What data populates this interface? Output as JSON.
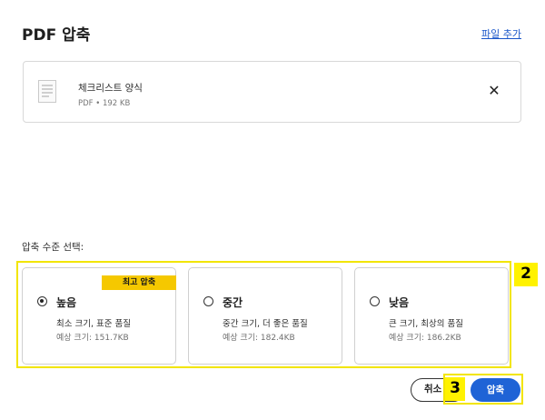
{
  "header": {
    "title": "PDF 압축",
    "add_file_label": "파일 추가"
  },
  "file": {
    "name": "체크리스트 양식",
    "meta": "PDF • 192 KB",
    "remove_glyph": "✕"
  },
  "level_label": "압축 수준 선택:",
  "options": [
    {
      "title": "높음",
      "badge": "최고 압축",
      "desc": "최소 크기, 표준 품질",
      "size": "예상 크기: 151.7KB",
      "selected": true
    },
    {
      "title": "중간",
      "desc": "중간 크기, 더 좋은 품질",
      "size": "예상 크기: 182.4KB",
      "selected": false
    },
    {
      "title": "낮음",
      "desc": "큰 크기, 최상의 품질",
      "size": "예상 크기: 186.2KB",
      "selected": false
    }
  ],
  "annotations": {
    "tag_options": "2",
    "tag_actions": "3"
  },
  "actions": {
    "cancel_label": "취소",
    "compress_label": "압축"
  },
  "colors": {
    "accent": "#1f63d6",
    "badge": "#f5c800",
    "highlight": "#fff200",
    "link": "#1a56c9"
  }
}
